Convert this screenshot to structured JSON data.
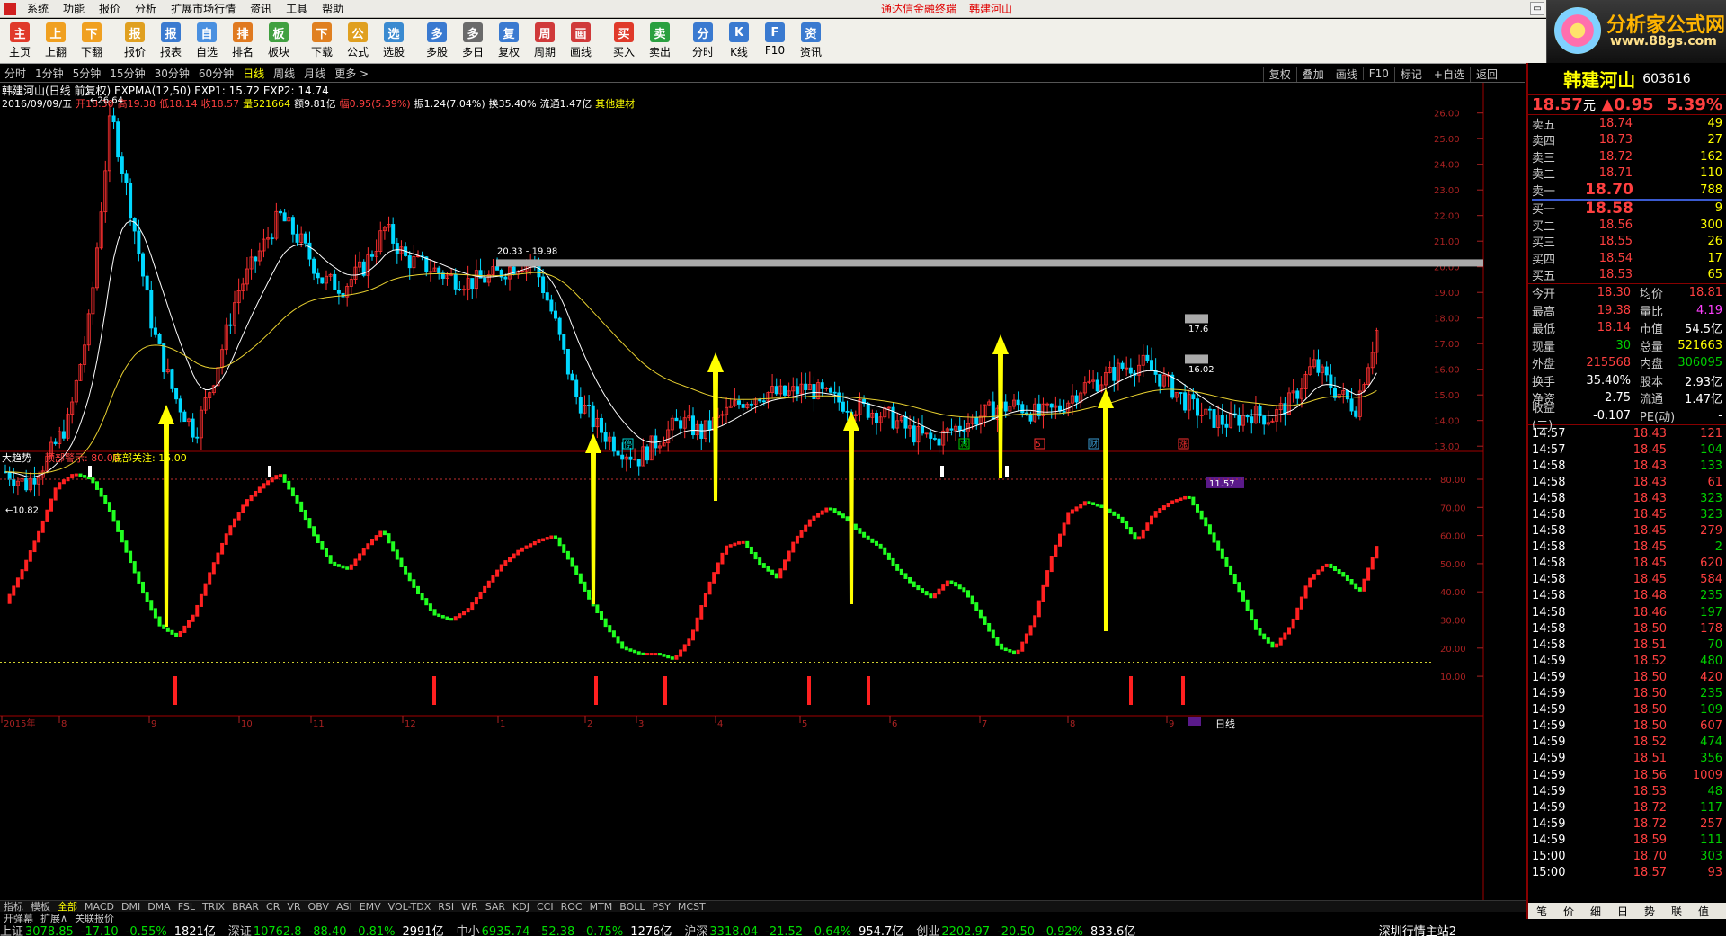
{
  "menu": {
    "items": [
      "系统",
      "功能",
      "报价",
      "分析",
      "扩展市场行情",
      "资讯",
      "工具",
      "帮助"
    ],
    "center_items": [
      "通达信金融终端",
      "韩建河山"
    ]
  },
  "logo": {
    "title": "分析家公式网",
    "url": "www.88gs.com"
  },
  "toolbar": {
    "buttons": [
      {
        "label": "主页",
        "icon": "home-icon",
        "color": "#e03a2a"
      },
      {
        "label": "上翻",
        "icon": "arrow-up-icon",
        "color": "#f0a020"
      },
      {
        "label": "下翻",
        "icon": "arrow-down-icon",
        "color": "#f0a020"
      },
      {
        "label": "报价",
        "icon": "yen-icon",
        "color": "#e0a020"
      },
      {
        "label": "报表",
        "icon": "report-icon",
        "color": "#3a7ad0"
      },
      {
        "label": "自选",
        "icon": "f6-icon",
        "color": "#4a90e0"
      },
      {
        "label": "排名",
        "icon": "rank-icon",
        "color": "#e07a20"
      },
      {
        "label": "板块",
        "icon": "block-icon",
        "color": "#40a040"
      },
      {
        "label": "下载",
        "icon": "download-icon",
        "color": "#e08020"
      },
      {
        "label": "公式",
        "icon": "formula-icon",
        "color": "#e0a020"
      },
      {
        "label": "选股",
        "icon": "select-stock-icon",
        "color": "#3a8ad0"
      },
      {
        "label": "多股",
        "icon": "multi-stock-icon",
        "color": "#3a7ad0"
      },
      {
        "label": "多日",
        "icon": "clock-icon",
        "color": "#6a6a6a"
      },
      {
        "label": "复权",
        "icon": "restore-icon",
        "color": "#3a7ad0"
      },
      {
        "label": "周期",
        "icon": "f8-icon",
        "color": "#d03a3a"
      },
      {
        "label": "画线",
        "icon": "draw-line-icon",
        "color": "#d03a3a"
      },
      {
        "label": "买入",
        "icon": "buy-icon",
        "color": "#e03a2a"
      },
      {
        "label": "卖出",
        "icon": "sell-icon",
        "color": "#2aa040"
      },
      {
        "label": "分时",
        "icon": "timeshare-icon",
        "color": "#3a7ad0"
      },
      {
        "label": "K线",
        "icon": "kline-icon",
        "color": "#3a7ad0"
      },
      {
        "label": "F10",
        "icon": "f10-icon",
        "color": "#3a7ad0"
      },
      {
        "label": "资讯",
        "icon": "news-icon",
        "color": "#3a7ad0"
      }
    ]
  },
  "periods": {
    "items": [
      "分时",
      "1分钟",
      "5分钟",
      "15分钟",
      "30分钟",
      "60分钟",
      "日线",
      "周线",
      "月线",
      "更多 >"
    ],
    "active": "日线"
  },
  "chart_tools": [
    "复权",
    "叠加",
    "画线",
    "F10",
    "标记",
    "+自选",
    "返回"
  ],
  "stock_info": {
    "line1": "韩建河山(日线 前复权) EXPMA(12,50) EXP1: 15.72 EXP2: 14.74",
    "date": "2016/09/09/五",
    "open": "开18.30",
    "high": "高19.38",
    "low": "低18.14",
    "close": "收18.57",
    "vol": "量521664",
    "amount": "额9.81亿",
    "amp": "幅0.95(5.39%)",
    "swing": "振1.24(7.04%)",
    "turnover": "换35.40%",
    "float": "流通1.47亿",
    "sector": "其他建材"
  },
  "main_chart": {
    "y_ticks": [
      "26.00",
      "25.00",
      "24.00",
      "23.00",
      "22.00",
      "21.00",
      "20.00",
      "19.00",
      "18.00",
      "17.00",
      "16.00",
      "15.00",
      "14.00",
      "13.00"
    ],
    "high_label": "26.64",
    "low_label": "10.82",
    "range_label": "20.33 - 19.98",
    "price_tags": [
      "17.6",
      "16.02"
    ],
    "last_tag": "11.57",
    "event_tags": [
      {
        "text": "停",
        "color": "#00d0d0"
      },
      {
        "text": "减",
        "color": "#00d000"
      },
      {
        "text": "5",
        "color": "#ff3030"
      },
      {
        "text": "财",
        "color": "#3a9ad0"
      },
      {
        "text": "涨",
        "color": "#ff3030"
      }
    ]
  },
  "indicator": {
    "name": "大趋势",
    "top_warn": "顶部警示: 80.00",
    "bottom_watch": "底部关注: 15.00",
    "y_ticks": [
      "80.00",
      "70.00",
      "60.00",
      "50.00",
      "40.00",
      "30.00",
      "20.00",
      "10.00"
    ]
  },
  "x_axis": {
    "labels": [
      "2015年",
      "8",
      "9",
      "10",
      "11",
      "12",
      "1",
      "2",
      "3",
      "4",
      "5",
      "6",
      "7",
      "8",
      "9",
      "日线"
    ]
  },
  "indicator_tabs": {
    "items": [
      "指标",
      "模板",
      "全部",
      "MACD",
      "DMI",
      "DMA",
      "FSL",
      "TRIX",
      "BRAR",
      "CR",
      "VR",
      "OBV",
      "ASI",
      "EMV",
      "VOL-TDX",
      "RSI",
      "WR",
      "SAR",
      "KDJ",
      "CCI",
      "ROC",
      "MTM",
      "BOLL",
      "PSY",
      "MCST"
    ],
    "active": "全部"
  },
  "bottom_tabs": [
    "开弹幕",
    "扩展∧",
    "关联报价"
  ],
  "quote": {
    "name": "韩建河山",
    "code": "603616",
    "price": "18.57",
    "unit": "元",
    "change": "▲0.95",
    "pct": "5.39%",
    "asks": [
      {
        "l": "卖五",
        "p": "18.74",
        "v": "49"
      },
      {
        "l": "卖四",
        "p": "18.73",
        "v": "27"
      },
      {
        "l": "卖三",
        "p": "18.72",
        "v": "162"
      },
      {
        "l": "卖二",
        "p": "18.71",
        "v": "110"
      },
      {
        "l": "卖一",
        "p": "18.70",
        "v": "788"
      }
    ],
    "bids": [
      {
        "l": "买一",
        "p": "18.58",
        "v": "9"
      },
      {
        "l": "买二",
        "p": "18.56",
        "v": "300"
      },
      {
        "l": "买三",
        "p": "18.55",
        "v": "26"
      },
      {
        "l": "买四",
        "p": "18.54",
        "v": "17"
      },
      {
        "l": "买五",
        "p": "18.53",
        "v": "65"
      }
    ],
    "stats": [
      [
        "今开",
        "18.30",
        "均价",
        "18.81"
      ],
      [
        "最高",
        "19.38",
        "量比",
        "4.19"
      ],
      [
        "最低",
        "18.14",
        "市值",
        "54.5亿"
      ],
      [
        "现量",
        "30",
        "总量",
        "521663"
      ],
      [
        "外盘",
        "215568",
        "内盘",
        "306095"
      ],
      [
        "换手",
        "35.40%",
        "股本",
        "2.93亿"
      ],
      [
        "净资",
        "2.75",
        "流通",
        "1.47亿"
      ],
      [
        "收益(二)",
        "-0.107",
        "PE(动)",
        "-"
      ]
    ],
    "ticks": [
      [
        "14:57",
        "18.43",
        "121"
      ],
      [
        "14:57",
        "18.45",
        "104"
      ],
      [
        "14:58",
        "18.43",
        "133"
      ],
      [
        "14:58",
        "18.43",
        "61"
      ],
      [
        "14:58",
        "18.43",
        "323"
      ],
      [
        "14:58",
        "18.45",
        "323"
      ],
      [
        "14:58",
        "18.45",
        "279"
      ],
      [
        "14:58",
        "18.45",
        "2"
      ],
      [
        "14:58",
        "18.45",
        "620"
      ],
      [
        "14:58",
        "18.45",
        "584"
      ],
      [
        "14:58",
        "18.48",
        "235"
      ],
      [
        "14:58",
        "18.46",
        "197"
      ],
      [
        "14:58",
        "18.50",
        "178"
      ],
      [
        "14:58",
        "18.51",
        "70"
      ],
      [
        "14:59",
        "18.52",
        "480"
      ],
      [
        "14:59",
        "18.50",
        "420"
      ],
      [
        "14:59",
        "18.50",
        "235"
      ],
      [
        "14:59",
        "18.50",
        "109"
      ],
      [
        "14:59",
        "18.50",
        "607"
      ],
      [
        "14:59",
        "18.52",
        "474"
      ],
      [
        "14:59",
        "18.51",
        "356"
      ],
      [
        "14:59",
        "18.56",
        "1009"
      ],
      [
        "14:59",
        "18.53",
        "48"
      ],
      [
        "14:59",
        "18.72",
        "117"
      ],
      [
        "14:59",
        "18.72",
        "257"
      ],
      [
        "14:59",
        "18.59",
        "111"
      ],
      [
        "15:00",
        "18.70",
        "303"
      ],
      [
        "15:00",
        "18.57",
        "93"
      ]
    ],
    "tabs": [
      "笔",
      "价",
      "细",
      "日",
      "势",
      "联",
      "值"
    ]
  },
  "status": {
    "items": [
      {
        "name": "上证",
        "v": "3078.85",
        "c": "-17.10",
        "p": "-0.55%",
        "a": "1821亿"
      },
      {
        "name": "深证",
        "v": "10762.8",
        "c": "-88.40",
        "p": "-0.81%",
        "a": "2991亿"
      },
      {
        "name": "中小",
        "v": "6935.74",
        "c": "-52.38",
        "p": "-0.75%",
        "a": "1276亿"
      },
      {
        "name": "沪深",
        "v": "3318.04",
        "c": "-21.52",
        "p": "-0.64%",
        "a": "954.7亿"
      },
      {
        "name": "创业",
        "v": "2202.97",
        "c": "-20.50",
        "p": "-0.92%",
        "a": "833.6亿"
      }
    ],
    "server": "深圳行情主站2"
  }
}
